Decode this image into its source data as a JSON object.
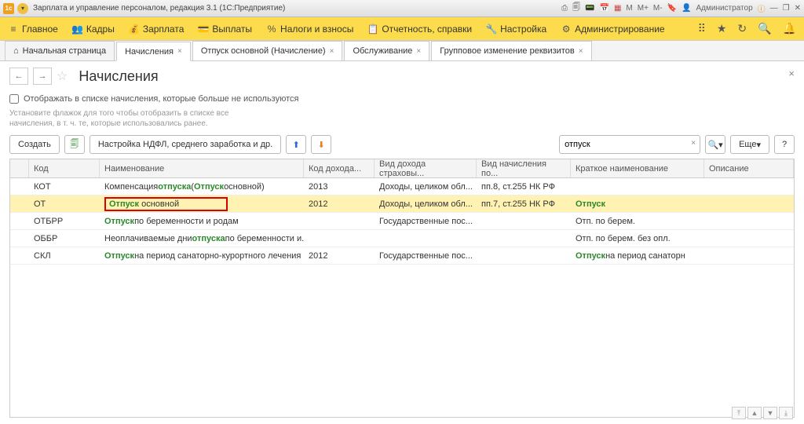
{
  "titlebar": {
    "title": "Зарплата и управление персоналом, редакция 3.1  (1С:Предприятие)",
    "user": "Администратор",
    "m1": "M",
    "m2": "M+",
    "m3": "M-"
  },
  "menu": {
    "main": "Главное",
    "kadry": "Кадры",
    "zarplata": "Зарплата",
    "vyplaty": "Выплаты",
    "nalogi": "Налоги и взносы",
    "otchet": "Отчетность, справки",
    "nastr": "Настройка",
    "admin": "Администрирование"
  },
  "tabs": {
    "start": "Начальная страница",
    "nac": "Начисления",
    "otp": "Отпуск основной (Начисление)",
    "obs": "Обслуживание",
    "grp": "Групповое изменение реквизитов"
  },
  "page": {
    "title": "Начисления",
    "checkbox": "Отображать в списке начисления, которые больше не используются",
    "hint": "Установите флажок для того чтобы отобразить в списке все начисления, в т. ч. те, которые использовались ранее.",
    "create": "Создать",
    "ndfl": "Настройка НДФЛ, среднего заработка и др.",
    "search_value": "отпуск",
    "more": "Еще"
  },
  "cols": {
    "code": "Код",
    "name": "Наименование",
    "inc": "Код дохода...",
    "ins": "Вид дохода страховы...",
    "nal": "Вид начисления по...",
    "short": "Краткое наименование",
    "desc": "Описание"
  },
  "rows": [
    {
      "code": "КОТ",
      "name_pre": "Компенсация ",
      "name_hl": "отпуска",
      "name_mid": " (",
      "name_hl2": "Отпуск",
      "name_post": " основной)",
      "inc": "2013",
      "ins": "Доходы, целиком обл...",
      "nal": "пп.8, ст.255 НК РФ",
      "short": "",
      "desc": ""
    },
    {
      "code": "ОТ",
      "name_pre": "",
      "name_hl": "Отпуск",
      "name_mid": " основной",
      "name_hl2": "",
      "name_post": "",
      "inc": "2012",
      "ins": "Доходы, целиком обл...",
      "nal": "пп.7, ст.255 НК РФ",
      "short_hl": "Отпуск",
      "short_post": "",
      "desc": "",
      "selected": true,
      "redbox": true
    },
    {
      "code": "ОТБРР",
      "name_pre": "",
      "name_hl": "Отпуск",
      "name_mid": " по беременности и родам",
      "name_hl2": "",
      "name_post": "",
      "inc": "",
      "ins": "Государственные пос...",
      "nal": "",
      "short": "Отп. по берем.",
      "desc": ""
    },
    {
      "code": "ОББР",
      "name_pre": "Неоплачиваемые дни ",
      "name_hl": "отпуска",
      "name_mid": " по беременности и...",
      "name_hl2": "",
      "name_post": "",
      "inc": "",
      "ins": "",
      "nal": "",
      "short": "Отп. по берем. без опл.",
      "desc": ""
    },
    {
      "code": "СКЛ",
      "name_pre": "",
      "name_hl": "Отпуск",
      "name_mid": " на период санаторно-курортного лечения ...",
      "name_hl2": "",
      "name_post": "",
      "inc": "2012",
      "ins": "Государственные пос...",
      "nal": "",
      "short_hl": "Отпуск",
      "short_post": " на период санаторн",
      "desc": ""
    }
  ]
}
